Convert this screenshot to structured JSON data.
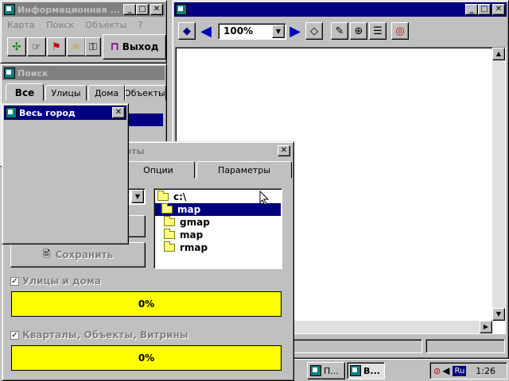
{
  "info_window": {
    "title": "Информационная ...",
    "menu": [
      "Карта",
      "Поиск",
      "Объекты",
      "?"
    ],
    "exit_label": "Выход"
  },
  "search_window": {
    "title": "Поиск",
    "tabs": [
      "Все",
      "Улицы",
      "Дома",
      "Объекты"
    ]
  },
  "city_window": {
    "title": "Весь город"
  },
  "map_window": {
    "title": "",
    "zoom": "100%"
  },
  "save_dialog": {
    "title": "...оты",
    "tabs": [
      "Опции",
      "Параметры"
    ],
    "drive": "c:\\",
    "folders": [
      "map",
      "gmap",
      "map",
      "rmap"
    ],
    "selected_folder": "map",
    "save_label": "Сохранить",
    "streets_label": "Улицы и дома",
    "streets_progress": "0%",
    "blocks_label": "Кварталы, Объекты, Витрины",
    "blocks_progress": "0%"
  },
  "taskbar": {
    "tasks": [
      "П...",
      "В..."
    ],
    "lang": "Ru",
    "clock": "1:26"
  },
  "colors": {
    "title_active": "#000080",
    "progress": "#ffff00",
    "face": "#c0c0c0"
  }
}
